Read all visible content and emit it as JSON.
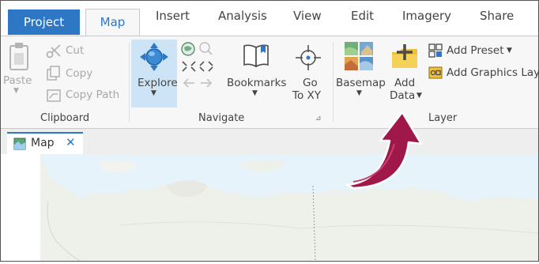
{
  "tabs": {
    "project": "Project",
    "map": "Map",
    "insert": "Insert",
    "analysis": "Analysis",
    "view": "View",
    "edit": "Edit",
    "imagery": "Imagery",
    "share": "Share"
  },
  "clipboard": {
    "paste": "Paste",
    "cut": "Cut",
    "copy": "Copy",
    "copy_path": "Copy Path",
    "label": "Clipboard"
  },
  "navigate": {
    "explore": "Explore",
    "bookmarks": "Bookmarks",
    "go_line1": "Go",
    "go_line2": "To XY",
    "label": "Navigate"
  },
  "layer": {
    "basemap": "Basemap",
    "add_line1": "Add",
    "add_line2": "Data",
    "add_preset": "Add Preset",
    "add_graphics_layer": "Add Graphics Laye",
    "label": "Layer"
  },
  "map_view": {
    "tab_label": "Map"
  },
  "colors": {
    "accent": "#2d77c4",
    "explore_highlight": "#cde4f7",
    "arrow": "#a0184a"
  }
}
